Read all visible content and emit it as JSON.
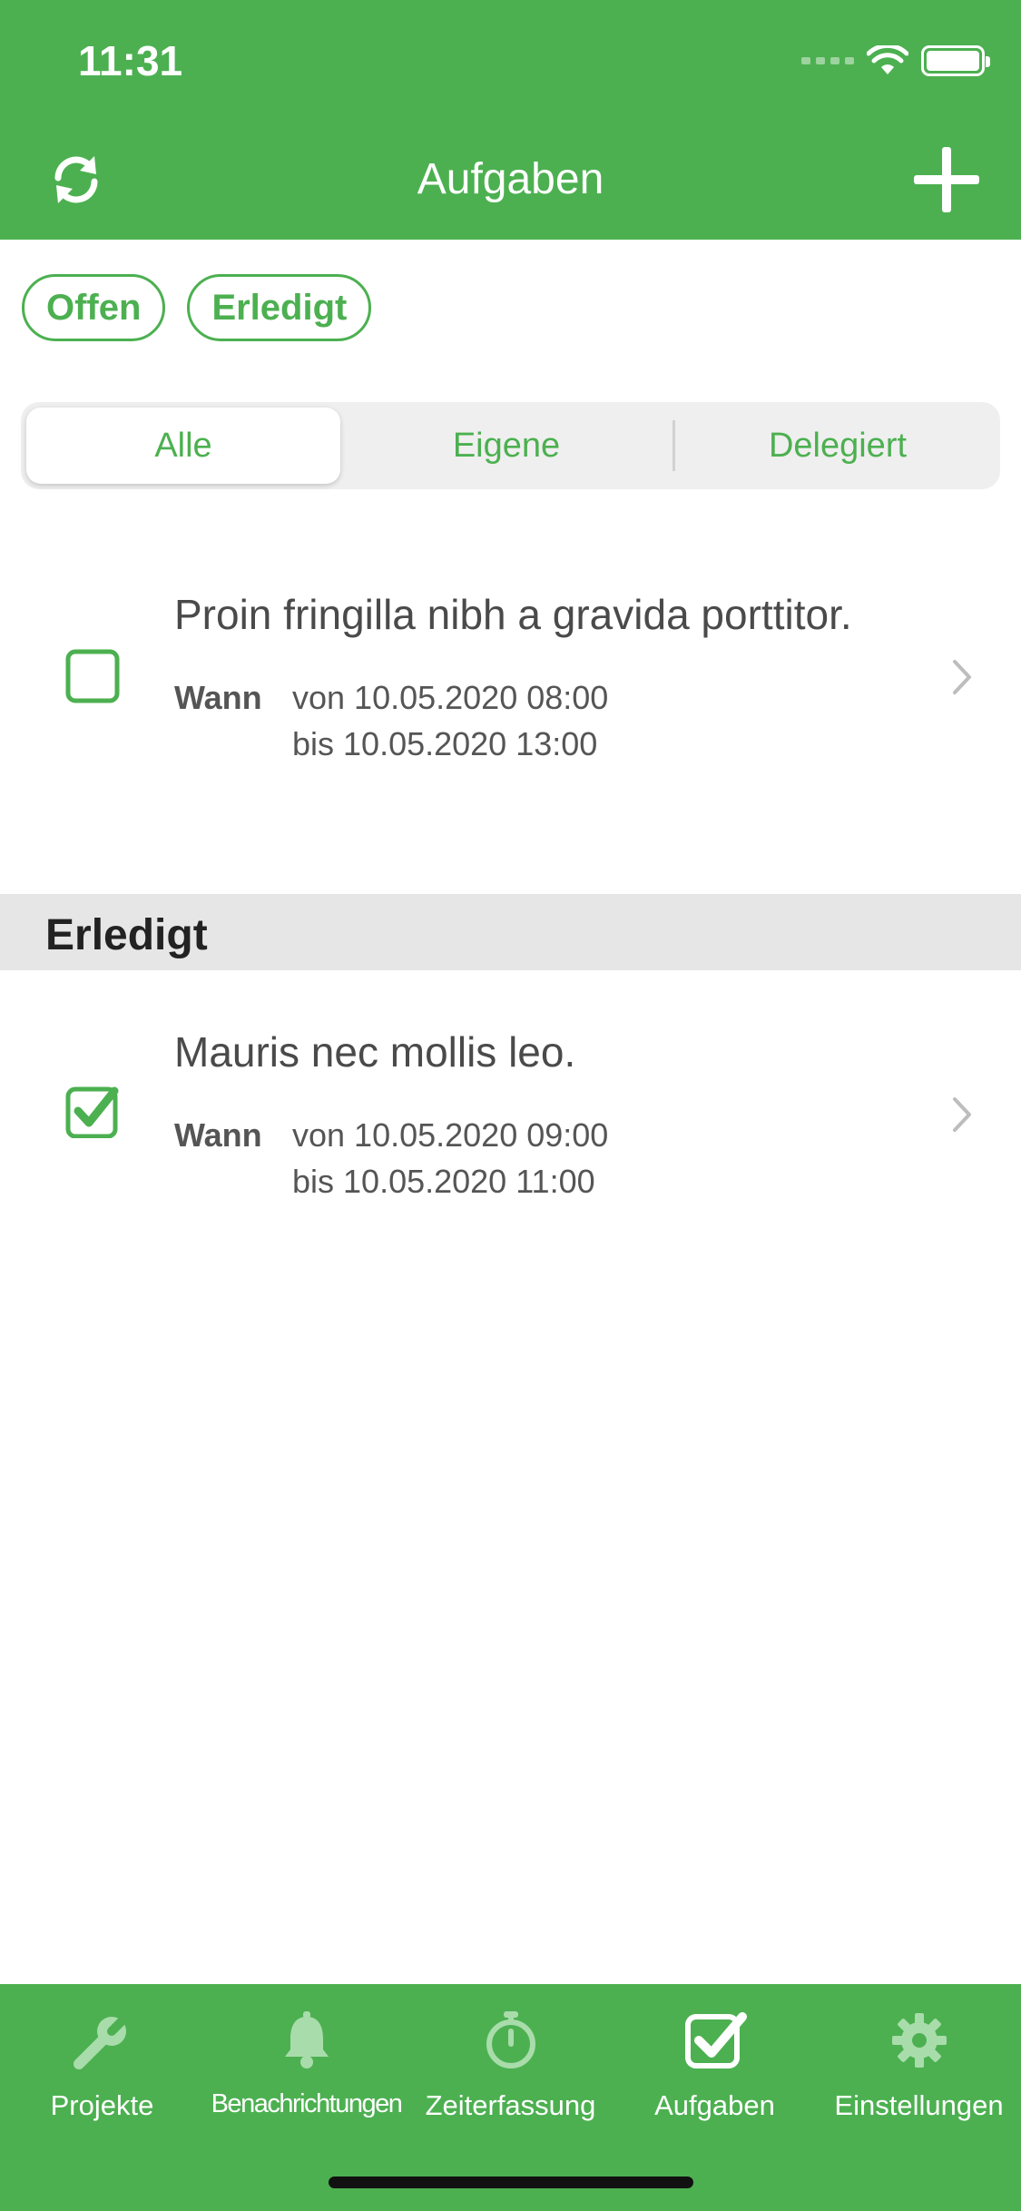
{
  "status_bar": {
    "time": "11:31"
  },
  "nav": {
    "title": "Aufgaben"
  },
  "filters": {
    "chips": [
      "Offen",
      "Erledigt"
    ]
  },
  "segments": {
    "items": [
      "Alle",
      "Eigene",
      "Delegiert"
    ],
    "selected": "Alle"
  },
  "tasks_open": [
    {
      "title": "Proin fringilla nibh a gravida porttitor.",
      "when_label": "Wann",
      "from": "von 10.05.2020 08:00",
      "to": "bis 10.05.2020 13:00",
      "done": false
    }
  ],
  "section_done": {
    "title": "Erledigt"
  },
  "tasks_done": [
    {
      "title": "Mauris nec mollis leo.",
      "when_label": "Wann",
      "from": "von 10.05.2020 09:00",
      "to": "bis 10.05.2020 11:00",
      "done": true
    }
  ],
  "tabbar": {
    "items": [
      {
        "label": "Projekte",
        "icon": "wrench-icon"
      },
      {
        "label": "Benachrichtungen",
        "icon": "bell-icon"
      },
      {
        "label": "Zeiterfassung",
        "icon": "stopwatch-icon"
      },
      {
        "label": "Aufgaben",
        "icon": "checkbox-icon",
        "active": true
      },
      {
        "label": "Einstellungen",
        "icon": "gear-icon"
      }
    ]
  },
  "colors": {
    "brand_green": "#4cb050",
    "section_bg": "#e6e6e6",
    "inactive_icon": "#a9dcab"
  }
}
